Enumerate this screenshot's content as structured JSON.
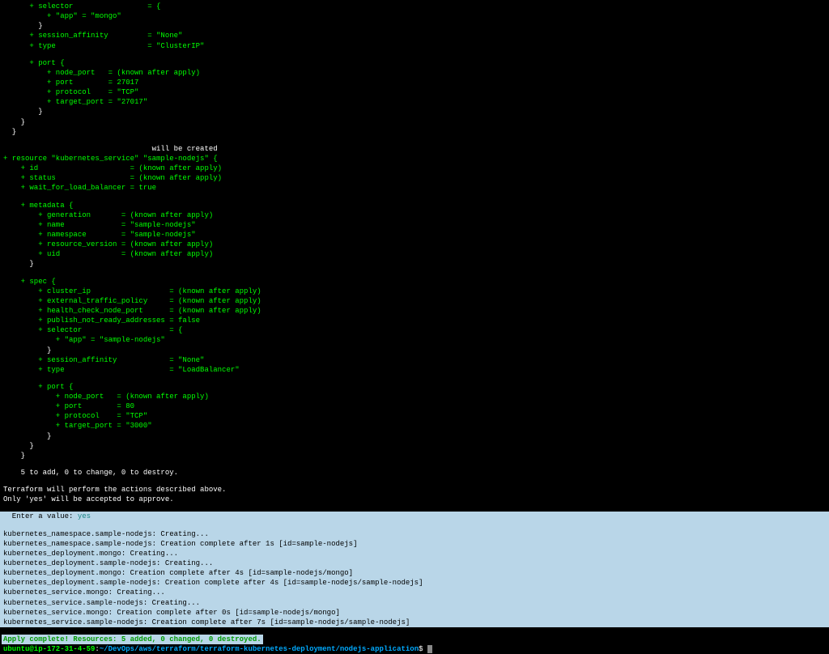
{
  "plan": {
    "selector_open": "      + selector                 = {",
    "selector_app": "          + \"app\" = \"mongo\"",
    "selector_close": "        }",
    "sess_aff": "      + session_affinity         = \"None\"",
    "svc_type": "      + type                     = \"ClusterIP\"",
    "port_open": "      + port {",
    "port_np": "          + node_port   = (known after apply)",
    "port_p": "          + port        = 27017",
    "port_proto": "          + protocol    = \"TCP\"",
    "port_tgt": "          + target_port = \"27017\"",
    "port_close": "        }",
    "spec_close": "    }",
    "res_close": "  }",
    "will_create": "                                  will be created",
    "res2_open": "+ resource \"kubernetes_service\" \"sample-nodejs\" {",
    "r2_id": "    + id                     = (known after apply)",
    "r2_status": "    + status                 = (known after apply)",
    "r2_wflb": "    + wait_for_load_balancer = true",
    "meta_open": "    + metadata {",
    "m_gen": "        + generation       = (known after apply)",
    "m_name": "        + name             = \"sample-nodejs\"",
    "m_ns": "        + namespace        = \"sample-nodejs\"",
    "m_rv": "        + resource_version = (known after apply)",
    "m_uid": "        + uid              = (known after apply)",
    "meta_close": "      }",
    "spec2_open": "    + spec {",
    "s2_cip": "        + cluster_ip                  = (known after apply)",
    "s2_etp": "        + external_traffic_policy     = (known after apply)",
    "s2_hcnp": "        + health_check_node_port      = (known after apply)",
    "s2_pnra": "        + publish_not_ready_addresses = false",
    "s2_sel_open": "        + selector                    = {",
    "s2_sel_app": "            + \"app\" = \"sample-nodejs\"",
    "s2_sel_close": "          }",
    "s2_sa": "        + session_affinity            = \"None\"",
    "s2_type": "        + type                        = \"LoadBalancer\"",
    "p2_open": "        + port {",
    "p2_np": "            + node_port   = (known after apply)",
    "p2_p": "            + port        = 80",
    "p2_proto": "            + protocol    = \"TCP\"",
    "p2_tgt": "            + target_port = \"3000\"",
    "p2_close": "          }",
    "spec2_close": "      }",
    "res2_close": "    }",
    "summary": "    5 to add, 0 to change, 0 to destroy.",
    "tf_action": "Terraform will perform the actions described above.",
    "tf_yes": "Only 'yes' will be accepted to approve."
  },
  "input": {
    "prompt": "  Enter a value: ",
    "value": "yes",
    "log1": "kubernetes_namespace.sample-nodejs: Creating...",
    "log2": "kubernetes_namespace.sample-nodejs: Creation complete after 1s [id=sample-nodejs]",
    "log3": "kubernetes_deployment.mongo: Creating...",
    "log4": "kubernetes_deployment.sample-nodejs: Creating...",
    "log5": "kubernetes_deployment.mongo: Creation complete after 4s [id=sample-nodejs/mongo]",
    "log6": "kubernetes_deployment.sample-nodejs: Creation complete after 4s [id=sample-nodejs/sample-nodejs]",
    "log7": "kubernetes_service.mongo: Creating...",
    "log8": "kubernetes_service.sample-nodejs: Creating...",
    "log9": "kubernetes_service.mongo: Creation complete after 0s [id=sample-nodejs/mongo]",
    "log10": "kubernetes_service.sample-nodejs: Creation complete after 7s [id=sample-nodejs/sample-nodejs]"
  },
  "apply": "Apply complete! Resources: 5 added, 0 changed, 0 destroyed.",
  "prompt": {
    "user": "ubuntu@ip-172-31-4-59",
    "colon": ":",
    "path": "~/DevOps/aws/terraform/terraform-kubernetes-deployment/nodejs-application",
    "dollar": "$ "
  }
}
